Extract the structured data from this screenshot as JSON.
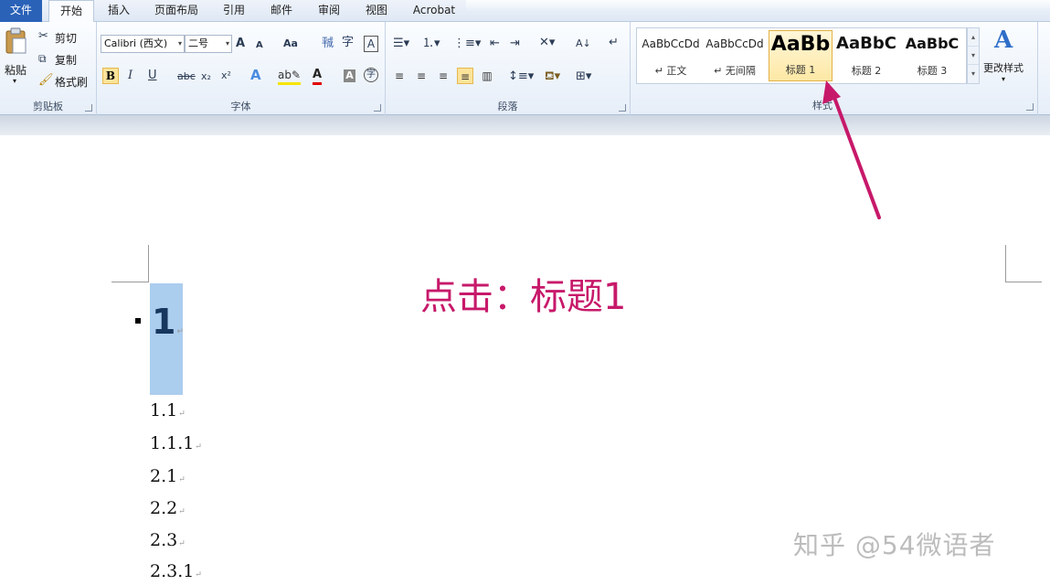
{
  "tabs": [
    {
      "label": "文件"
    },
    {
      "label": "开始"
    },
    {
      "label": "插入"
    },
    {
      "label": "页面布局"
    },
    {
      "label": "引用"
    },
    {
      "label": "邮件"
    },
    {
      "label": "审阅"
    },
    {
      "label": "视图"
    },
    {
      "label": "Acrobat"
    }
  ],
  "clipboard": {
    "paste": "粘贴",
    "cut": "剪切",
    "copy": "复制",
    "format_painter": "格式刷",
    "group_label": "剪贴板"
  },
  "font": {
    "font_name": "Calibri (西文)",
    "font_size": "二号",
    "group_label": "字体",
    "bold": "B",
    "italic": "I",
    "underline": "U",
    "strike": "abc",
    "subscript": "x₂",
    "superscript": "x²",
    "grow": "A",
    "shrink": "A",
    "change_case": "Aa",
    "font_color": "A",
    "char_shading": "A",
    "enclose": "字"
  },
  "paragraph": {
    "group_label": "段落"
  },
  "styles": {
    "items": [
      {
        "preview": "AaBbCcDd",
        "name": "↵ 正文"
      },
      {
        "preview": "AaBbCcDd",
        "name": "↵ 无间隔"
      },
      {
        "preview": "AaBb",
        "name": "标题 1"
      },
      {
        "preview": "AaBbC",
        "name": "标题 2"
      },
      {
        "preview": "AaBbC",
        "name": "标题 3"
      }
    ],
    "change_styles": "更改样式",
    "group_label": "样式"
  },
  "document": {
    "heading": "1",
    "paragraphs": [
      "1.1",
      "1.1.1",
      "2.1",
      "2.2",
      "2.3",
      "2.3.1"
    ],
    "return_mark": "↵"
  },
  "annotation": "点击：标题1",
  "watermark": "知乎 @54微语者",
  "colors": {
    "file_tab": "#2a62b8",
    "annotation": "#c7196a",
    "selection": "#abcdee",
    "heading_text": "#17375e"
  }
}
